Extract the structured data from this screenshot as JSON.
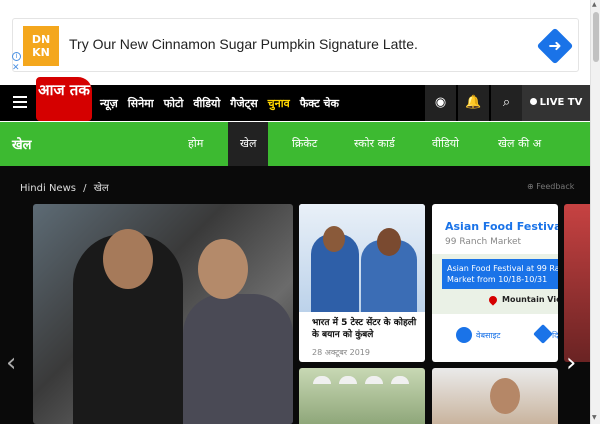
{
  "ad": {
    "logo_text_1": "DN",
    "logo_text_2": "KN",
    "headline": "Try Our New Cinnamon Sugar Pumpkin Signature Latte.",
    "info_icon": "info-icon",
    "close_label": "✕"
  },
  "header": {
    "logo_text": "आज तक",
    "nav": [
      "न्यूज़",
      "सिनेमा",
      "फोटो",
      "वीडियो",
      "गैजेट्स",
      "चुनाव",
      "फैक्ट चेक"
    ],
    "live_tv_label": "LIVE TV",
    "icons": [
      "podcast-icon",
      "notification-bell-icon",
      "search-icon"
    ]
  },
  "section": {
    "title": "खेल",
    "tabs": [
      "होम",
      "खेल",
      "क्रिकेट",
      "स्कोर कार्ड",
      "वीडियो",
      "खेल की अ"
    ]
  },
  "breadcrumb": {
    "home": "Hindi News",
    "separator": "/",
    "current": "खेल"
  },
  "feedback_label": "Feedback",
  "news_card": {
    "title": "भारत में 5 टेस्ट सेंटर के कोहली के बयान को कुंबले",
    "date": "28 अक्टूबर 2019"
  },
  "ad_card": {
    "title": "Asian Food Festival",
    "subtitle": "99 Ranch Market",
    "map_text_1": "Asian Food Festival at 99 Ranch",
    "map_text_2": "Market from 10/18-10/31",
    "location": "Mountain View",
    "action_1": "वेबसाइट",
    "action_2": "दि"
  },
  "colors": {
    "brand_red": "#d50000",
    "section_green": "#3dba31",
    "nav_black": "#000000",
    "accent_yellow": "#ffd600",
    "ad_blue": "#1a73e8"
  }
}
